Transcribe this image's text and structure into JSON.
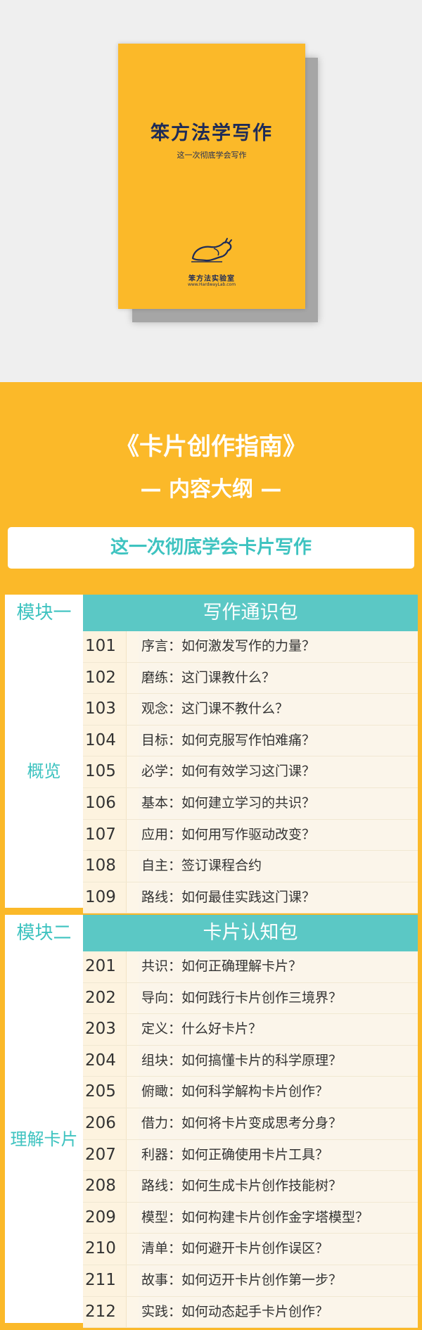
{
  "cover": {
    "title": "笨方法学写作",
    "subtitle": "这一次彻底学会写作",
    "publisher": "笨方法实验室",
    "publisher_url": "www.HardwayLab.com"
  },
  "header": {
    "title": "《卡片创作指南》",
    "subtitle": "— 内容大纲 —",
    "banner": "这一次彻底学会卡片写作"
  },
  "colors": {
    "background": "#fbb929",
    "teal": "#5bc8c5",
    "teal_text": "#3ec3c0",
    "navy": "#1e2b57"
  },
  "modules": [
    {
      "label": "模块一",
      "name": "写作通识包",
      "side": "概览",
      "items": [
        {
          "num": "101",
          "text": "序言：如何激发写作的力量？"
        },
        {
          "num": "102",
          "text": "磨练：这门课教什么？"
        },
        {
          "num": "103",
          "text": "观念：这门课不教什么？"
        },
        {
          "num": "104",
          "text": "目标：如何克服写作怕难痛？"
        },
        {
          "num": "105",
          "text": "必学：如何有效学习这门课？"
        },
        {
          "num": "106",
          "text": "基本：如何建立学习的共识？"
        },
        {
          "num": "107",
          "text": "应用：如何用写作驱动改变？"
        },
        {
          "num": "108",
          "text": "自主：签订课程合约"
        },
        {
          "num": "109",
          "text": "路线：如何最佳实践这门课？"
        }
      ]
    },
    {
      "label": "模块二",
      "name": "卡片认知包",
      "side": "理解卡片",
      "items": [
        {
          "num": "201",
          "text": "共识：如何正确理解卡片？"
        },
        {
          "num": "202",
          "text": "导向：如何践行卡片创作三境界？"
        },
        {
          "num": "203",
          "text": "定义：什么好卡片？"
        },
        {
          "num": "204",
          "text": "组块：如何搞懂卡片的科学原理？"
        },
        {
          "num": "205",
          "text": "俯瞰：如何科学解构卡片创作？"
        },
        {
          "num": "206",
          "text": "借力：如何将卡片变成思考分身？"
        },
        {
          "num": "207",
          "text": "利器：如何正确使用卡片工具？"
        },
        {
          "num": "208",
          "text": "路线：如何生成卡片创作技能树？"
        },
        {
          "num": "209",
          "text": "模型：如何构建卡片创作金字塔模型？"
        },
        {
          "num": "210",
          "text": "清单：如何避开卡片创作误区？"
        },
        {
          "num": "211",
          "text": "故事：如何迈开卡片创作第一步？"
        },
        {
          "num": "212",
          "text": "实践：如何动态起手卡片创作？"
        }
      ]
    }
  ]
}
